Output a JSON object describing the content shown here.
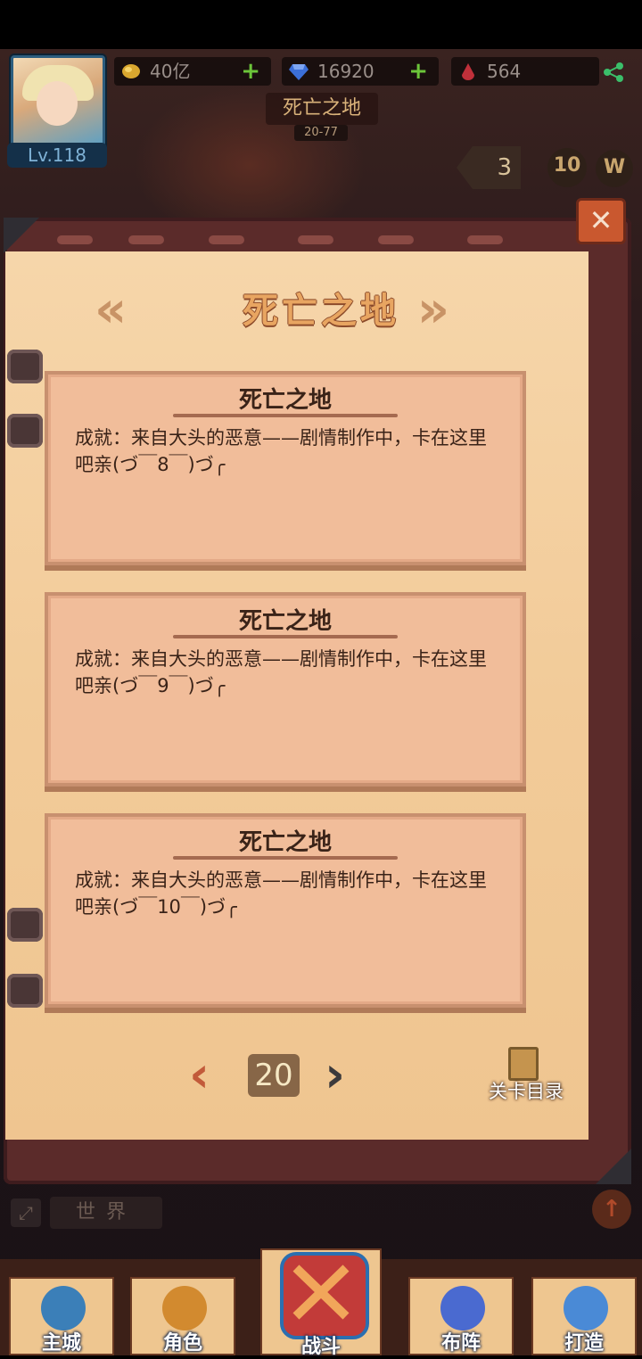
{
  "player": {
    "level": "Lv.118"
  },
  "resources": {
    "gold": "40亿",
    "gems": "16920",
    "blood": "564"
  },
  "stage": {
    "name": "死亡之地",
    "range": "20-77",
    "speed": "3",
    "exp_badge": "10",
    "w_badge": "W"
  },
  "book": {
    "title": "死亡之地",
    "prev_arrow": "«",
    "next_arrow": "»",
    "close": "✕",
    "cards": [
      {
        "title": "死亡之地",
        "desc": "成就：来自大头的恶意——剧情制作中，卡在这里吧亲(づ￣8￣)づ╭"
      },
      {
        "title": "死亡之地",
        "desc": "成就：来自大头的恶意——剧情制作中，卡在这里吧亲(づ￣9￣)づ╭"
      },
      {
        "title": "死亡之地",
        "desc": "成就：来自大头的恶意——剧情制作中，卡在这里吧亲(づ￣10￣)づ╭"
      }
    ],
    "page_number": "20",
    "page_prev": "‹",
    "page_next": "›",
    "catalog_label": "关卡目录"
  },
  "chat": {
    "world_tab": "世界",
    "expand": "⤢",
    "up": "↑"
  },
  "nav": [
    {
      "label": "主城"
    },
    {
      "label": "角色"
    },
    {
      "label": "战斗"
    },
    {
      "label": "布阵"
    },
    {
      "label": "打造"
    }
  ],
  "colors": {
    "parchment": "#f3cfa0",
    "card": "#f1bd9a",
    "book_frame": "#5b2b2a",
    "title_orange": "#e8a561",
    "close_button": "#c9582f"
  }
}
